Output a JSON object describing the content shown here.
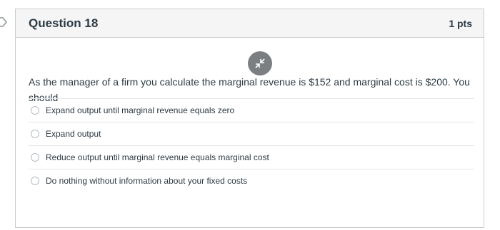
{
  "question": {
    "title": "Question 18",
    "points": "1 pts",
    "text": "As the manager of a firm you calculate the marginal revenue is $152 and marginal cost is $200. You should",
    "answers": [
      {
        "label": "Expand output until marginal revenue equals zero",
        "selected": false
      },
      {
        "label": "Expand output",
        "selected": false
      },
      {
        "label": "Reduce output until marginal revenue equals marginal cost",
        "selected": false
      },
      {
        "label": "Do nothing without information about your fixed costs",
        "selected": false
      }
    ]
  },
  "icons": {
    "flag": "flag-outline-icon",
    "collapse": "collapse-arrows-icon"
  },
  "colors": {
    "header_bg": "#f5f5f5",
    "border": "#c7cdd1",
    "text": "#2d3b45",
    "collapse_bg": "#7b7f82"
  }
}
